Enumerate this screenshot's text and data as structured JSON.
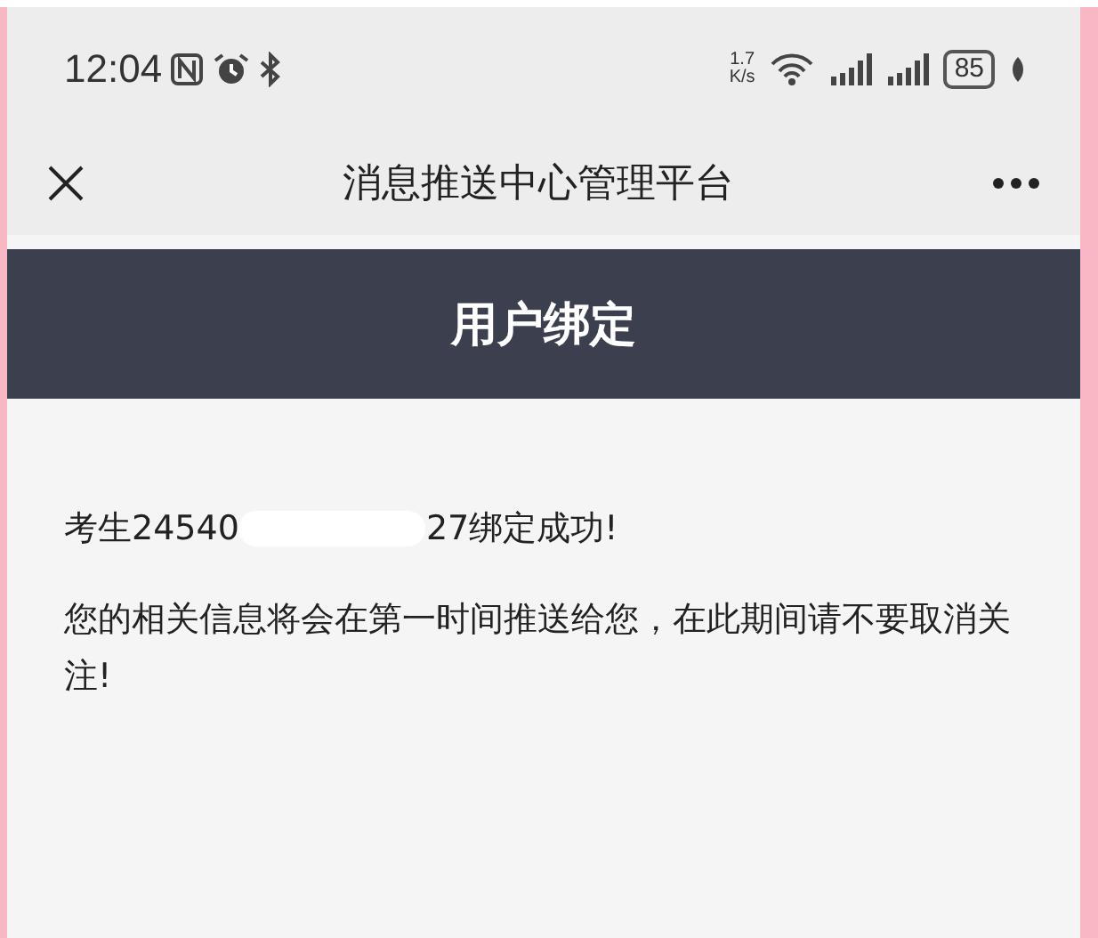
{
  "status_bar": {
    "time": "12:04",
    "speed_value": "1.7",
    "speed_unit": "K/s",
    "battery": "85"
  },
  "nav_bar": {
    "title": "消息推送中心管理平台"
  },
  "header": {
    "title": "用户绑定"
  },
  "message": {
    "success_before": "考生24540",
    "success_after": "27绑定成功!",
    "notice": "您的相关信息将会在第一时间推送给您，在此期间请不要取消关注!"
  }
}
